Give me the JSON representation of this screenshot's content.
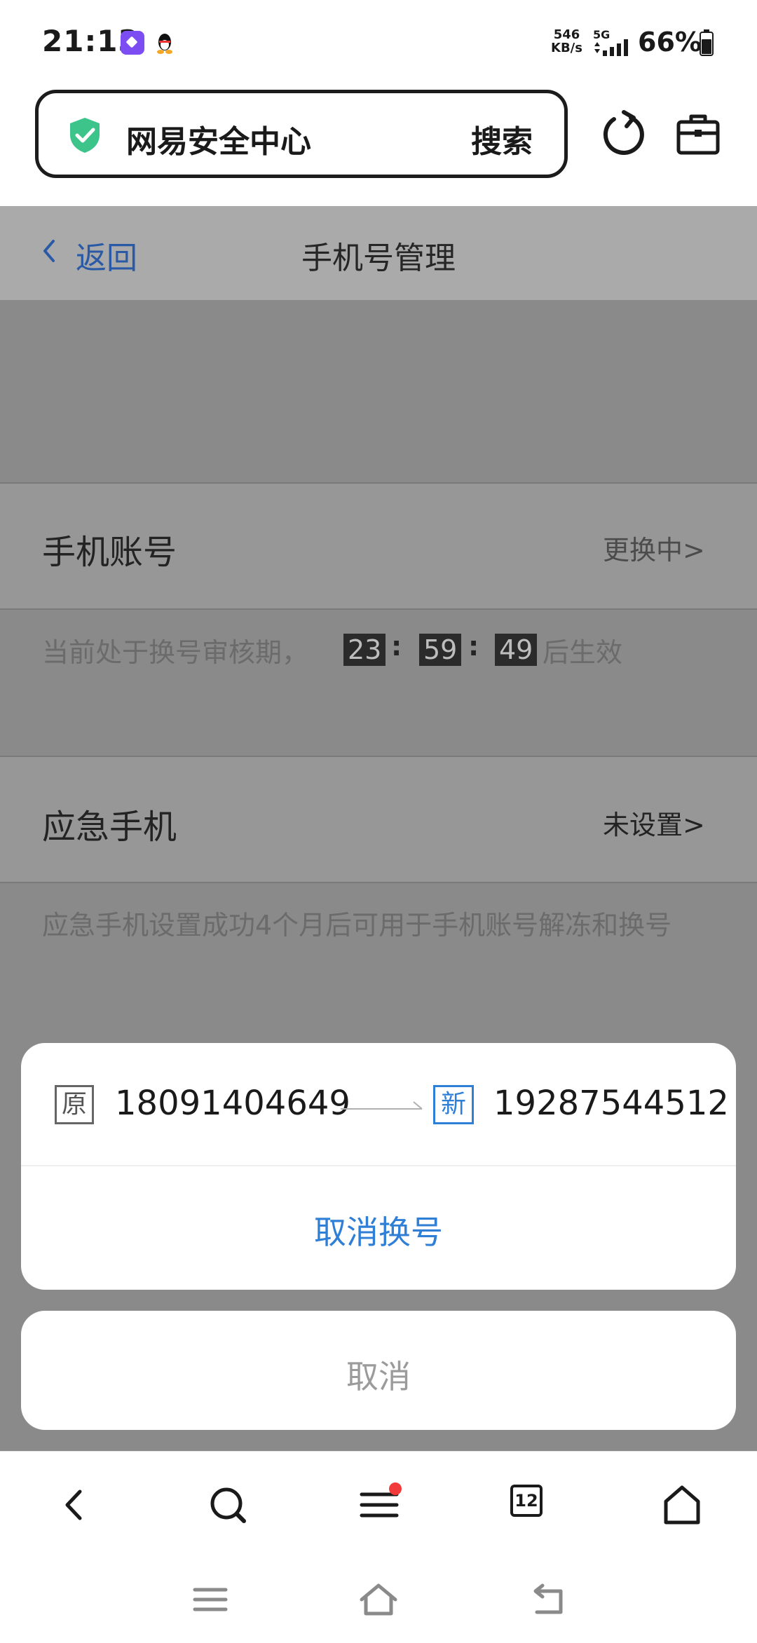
{
  "status_bar": {
    "time": "21:13",
    "net_speed_value": "546",
    "net_speed_unit": "KB/s",
    "network": "5G",
    "battery": "66%"
  },
  "browser": {
    "site_name": "网易安全中心",
    "search_label": "搜索",
    "tabs_count": "12"
  },
  "header": {
    "back_label": "返回",
    "title": "手机号管理"
  },
  "phone_account": {
    "label": "手机账号",
    "status": "更换中>",
    "pending_prefix": "当前处于换号审核期，",
    "countdown_h": "23",
    "countdown_m": "59",
    "countdown_s": "49",
    "pending_suffix": "后生效"
  },
  "emergency_phone": {
    "label": "应急手机",
    "status": "未设置>",
    "note": "应急手机设置成功4个月后可用于手机账号解冻和换号"
  },
  "sheet": {
    "old_tag": "原",
    "old_number": "18091404649",
    "new_tag": "新",
    "new_number": "19287544512",
    "cancel_change": "取消换号",
    "cancel": "取消"
  },
  "colors": {
    "accent": "#2f7fd6",
    "header_link": "#2a5aa6",
    "shield": "#3cc48a",
    "notification_dot": "#f23a3a"
  },
  "icons": [
    "app-badge-icon",
    "qq-icon",
    "signal-icon",
    "battery-icon",
    "shield-check-icon",
    "reload-icon",
    "toolbox-icon",
    "back-chevron-icon",
    "arrow-right-icon",
    "back-nav-icon",
    "search-icon",
    "menu-icon",
    "tabs-icon",
    "home-icon",
    "sys-menu-icon",
    "sys-home-icon",
    "sys-back-icon"
  ]
}
